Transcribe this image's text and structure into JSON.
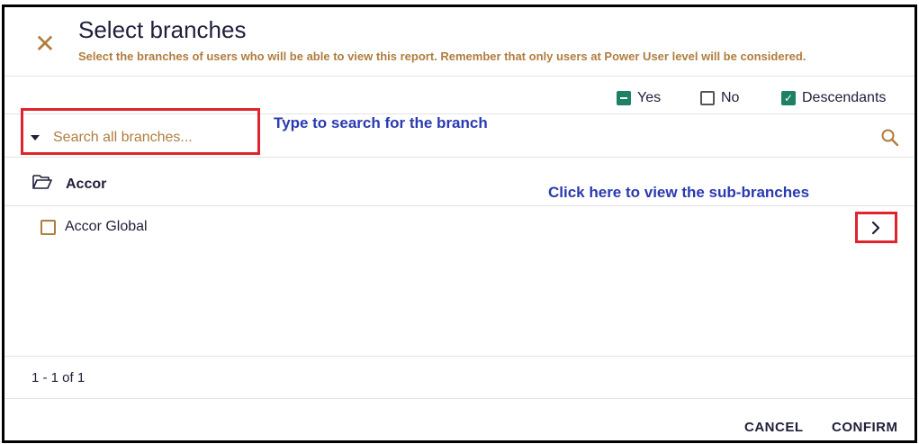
{
  "dialog": {
    "title": "Select branches",
    "subtitle": "Select the branches of users who will be able to view this report. Remember that only users at Power User level will be considered.",
    "close_icon": "close-icon"
  },
  "legend": {
    "yes_label": "Yes",
    "no_label": "No",
    "descendants_label": "Descendants"
  },
  "search": {
    "placeholder": "Search all branches...",
    "value": ""
  },
  "annotations": {
    "search_hint": "Type to search for the branch",
    "subbranch_hint": "Click here to view the sub-branches"
  },
  "tree": {
    "group_label": "Accor",
    "items": [
      {
        "label": "Accor Global",
        "checked": false
      }
    ]
  },
  "pagination": {
    "text": "1 - 1 of 1"
  },
  "actions": {
    "cancel": "CANCEL",
    "confirm": "CONFIRM"
  },
  "colors": {
    "accent": "#b07d3f",
    "checkbox_green": "#1e8165",
    "highlight_red": "#e0242d",
    "annotation_blue": "#2a3ab0"
  }
}
